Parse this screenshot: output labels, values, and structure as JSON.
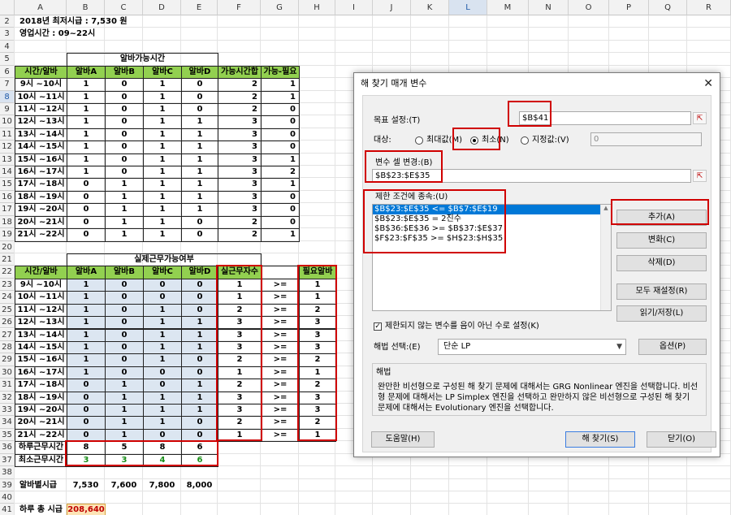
{
  "spreadsheet": {
    "columns": [
      "A",
      "B",
      "C",
      "D",
      "E",
      "F",
      "G",
      "H",
      "I",
      "J",
      "K",
      "L",
      "M",
      "N",
      "O",
      "P",
      "Q",
      "R"
    ],
    "selected_column": "L",
    "row_numbers": [
      "2",
      "3",
      "4",
      "5",
      "6",
      "7",
      "8",
      "9",
      "10",
      "11",
      "12",
      "13",
      "14",
      "15",
      "16",
      "17",
      "18",
      "19",
      "20",
      "21",
      "22",
      "23",
      "24",
      "25",
      "26",
      "27",
      "28",
      "29",
      "30",
      "31",
      "32",
      "33",
      "34",
      "35",
      "36",
      "37",
      "38",
      "39",
      "40",
      "41"
    ],
    "selected_row": "8",
    "min_wage_note": "2018년 최저시급 : 7,530 원",
    "hours_note": "영업시간 : 09~22시",
    "table1": {
      "title": "알바가능시간",
      "headers": [
        "시간/알바",
        "알바A",
        "알바B",
        "알바C",
        "알바D",
        "가능시간합",
        "가능-필요"
      ],
      "rows": [
        [
          "9시 ~10시",
          "1",
          "0",
          "1",
          "0",
          "2",
          "1"
        ],
        [
          "10시 ~11시",
          "1",
          "0",
          "1",
          "0",
          "2",
          "1"
        ],
        [
          "11시 ~12시",
          "1",
          "0",
          "1",
          "0",
          "2",
          "0"
        ],
        [
          "12시 ~13시",
          "1",
          "0",
          "1",
          "1",
          "3",
          "0"
        ],
        [
          "13시 ~14시",
          "1",
          "0",
          "1",
          "1",
          "3",
          "0"
        ],
        [
          "14시 ~15시",
          "1",
          "0",
          "1",
          "1",
          "3",
          "0"
        ],
        [
          "15시 ~16시",
          "1",
          "0",
          "1",
          "1",
          "3",
          "1"
        ],
        [
          "16시 ~17시",
          "1",
          "0",
          "1",
          "1",
          "3",
          "2"
        ],
        [
          "17시 ~18시",
          "0",
          "1",
          "1",
          "1",
          "3",
          "1"
        ],
        [
          "18시 ~19시",
          "0",
          "1",
          "1",
          "1",
          "3",
          "0"
        ],
        [
          "19시 ~20시",
          "0",
          "1",
          "1",
          "1",
          "3",
          "0"
        ],
        [
          "20시 ~21시",
          "0",
          "1",
          "1",
          "0",
          "2",
          "0"
        ],
        [
          "21시 ~22시",
          "0",
          "1",
          "1",
          "0",
          "2",
          "1"
        ]
      ]
    },
    "table2": {
      "title": "실제근무가능여부",
      "headers": [
        "시간/알바",
        "알바A",
        "알바B",
        "알바C",
        "알바D",
        "실근무자수",
        "",
        "필요알바"
      ],
      "rows": [
        [
          "9시 ~10시",
          "1",
          "0",
          "0",
          "0",
          "1",
          ">=",
          "1"
        ],
        [
          "10시 ~11시",
          "1",
          "0",
          "0",
          "0",
          "1",
          ">=",
          "1"
        ],
        [
          "11시 ~12시",
          "1",
          "0",
          "1",
          "0",
          "2",
          ">=",
          "2"
        ],
        [
          "12시 ~13시",
          "1",
          "0",
          "1",
          "1",
          "3",
          ">=",
          "3"
        ],
        [
          "13시 ~14시",
          "1",
          "0",
          "1",
          "1",
          "3",
          ">=",
          "3"
        ],
        [
          "14시 ~15시",
          "1",
          "0",
          "1",
          "1",
          "3",
          ">=",
          "3"
        ],
        [
          "15시 ~16시",
          "1",
          "0",
          "1",
          "0",
          "2",
          ">=",
          "2"
        ],
        [
          "16시 ~17시",
          "1",
          "0",
          "0",
          "0",
          "1",
          ">=",
          "1"
        ],
        [
          "17시 ~18시",
          "0",
          "1",
          "0",
          "1",
          "2",
          ">=",
          "2"
        ],
        [
          "18시 ~19시",
          "0",
          "1",
          "1",
          "1",
          "3",
          ">=",
          "3"
        ],
        [
          "19시 ~20시",
          "0",
          "1",
          "1",
          "1",
          "3",
          ">=",
          "3"
        ],
        [
          "20시 ~21시",
          "0",
          "1",
          "1",
          "0",
          "2",
          ">=",
          "2"
        ],
        [
          "21시 ~22시",
          "0",
          "1",
          "0",
          "0",
          "1",
          ">=",
          "1"
        ]
      ],
      "daily_hours_label": "하루근무시간",
      "daily_hours": [
        "8",
        "5",
        "8",
        "6"
      ],
      "min_hours_label": "최소근무시간",
      "min_hours": [
        "3",
        "3",
        "4",
        "6"
      ]
    },
    "wage_label": "알바별시급",
    "wages": [
      "7,530",
      "7,600",
      "7,800",
      "8,000"
    ],
    "total_label": "하루 총 시급",
    "total_value": "208,640"
  },
  "dialog": {
    "title": "해 찾기 매개 변수",
    "close_glyph": "✕",
    "objective_label": "목표 설정:(T)",
    "objective_value": "$B$41",
    "to_label": "대상:",
    "opt_max": "최대값(M)",
    "opt_min": "최소(N)",
    "opt_value": "지정값:(V)",
    "value_of": "0",
    "changing_label": "변수 셀 변경:(B)",
    "changing_value": "$B$23:$E$35",
    "constraints_label": "제한 조건에 종속:(U)",
    "constraints": [
      "$B$23:$E$35 <= $B$7:$E$19",
      "$B$23:$E$35 = 2진수",
      "$B$36:$E$36 >= $B$37:$E$37",
      "$F$23:$F$35 >= $H$23:$H$35"
    ],
    "btn_add": "추가(A)",
    "btn_change": "변화(C)",
    "btn_delete": "삭제(D)",
    "btn_reset": "모두 재설정(R)",
    "btn_load": "읽기/저장(L)",
    "nonneg_label": "제한되지 않는 변수를 음이 아닌 수로 설정(K)",
    "method_label": "해법 선택:(E)",
    "method_value": "단순 LP",
    "btn_options": "옵션(P)",
    "solving_title": "해법",
    "solving_text": "완만한 비선형으로 구성된 해 찾기 문제에 대해서는 GRG Nonlinear 엔진을 선택합니다. 비선형 문제에 대해서는 LP Simplex 엔진을 선택하고 완만하지 않은 비선형으로 구성된 해 찾기 문제에 대해서는 Evolutionary 엔진을 선택합니다.",
    "btn_help": "도움말(H)",
    "btn_solve": "해 찾기(S)",
    "btn_close": "닫기(O)",
    "ref_glyph": "⇱"
  }
}
